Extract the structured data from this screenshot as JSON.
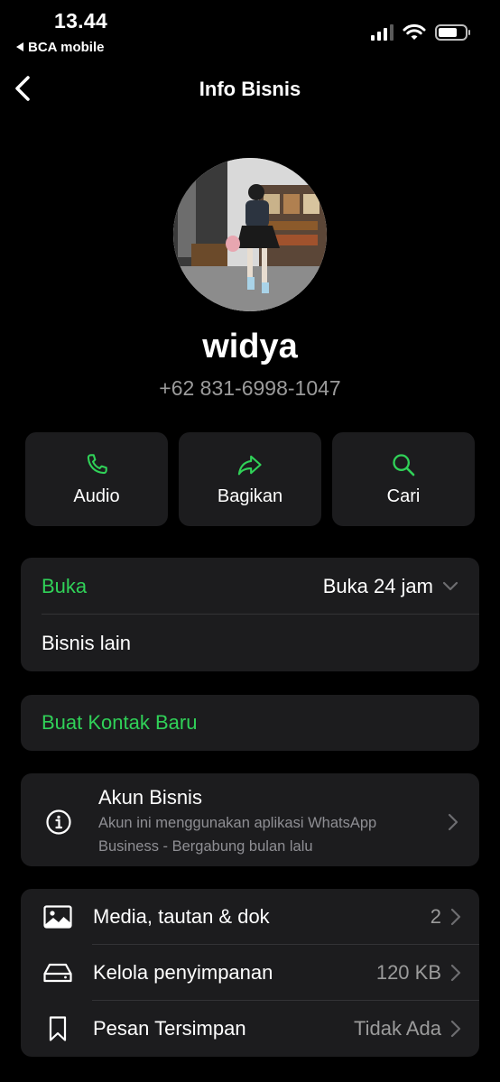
{
  "status": {
    "time": "13.44",
    "back_app": "BCA mobile"
  },
  "nav": {
    "title": "Info Bisnis"
  },
  "profile": {
    "name": "widya",
    "phone": "+62 831-6998-1047"
  },
  "actions": [
    {
      "label": "Audio",
      "icon": "phone-icon"
    },
    {
      "label": "Bagikan",
      "icon": "share-icon"
    },
    {
      "label": "Cari",
      "icon": "search-icon"
    }
  ],
  "hours": {
    "status_label": "Buka",
    "status_value": "Buka 24 jam",
    "other_label": "Bisnis lain"
  },
  "new_contact": {
    "label": "Buat Kontak Baru"
  },
  "business_account": {
    "title": "Akun Bisnis",
    "subtitle": "Akun ini menggunakan aplikasi WhatsApp Business - Bergabung bulan lalu"
  },
  "media": [
    {
      "label": "Media, tautan & dok",
      "value": "2",
      "icon": "image-icon"
    },
    {
      "label": "Kelola penyimpanan",
      "value": "120 KB",
      "icon": "storage-icon"
    },
    {
      "label": "Pesan Tersimpan",
      "value": "Tidak Ada",
      "icon": "bookmark-icon"
    }
  ],
  "colors": {
    "accent": "#30d158",
    "background": "#000000",
    "card": "#1c1c1e",
    "secondary_text": "#9b9b9b"
  }
}
